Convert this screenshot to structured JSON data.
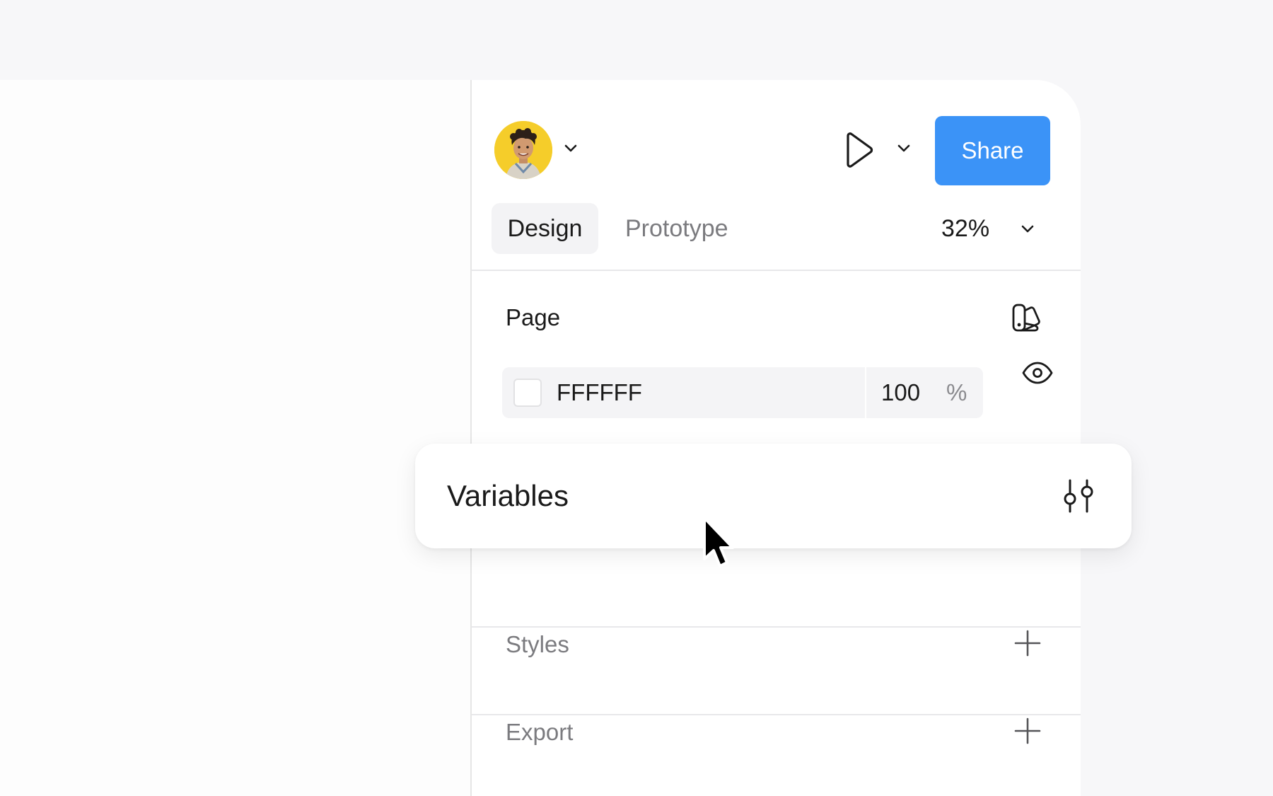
{
  "header": {
    "share_label": "Share"
  },
  "tabs": [
    {
      "label": "Design",
      "active": true
    },
    {
      "label": "Prototype",
      "active": false
    }
  ],
  "zoom": "32%",
  "page_section": {
    "title": "Page",
    "fill": {
      "hex": "FFFFFF",
      "opacity": "100",
      "unit": "%"
    }
  },
  "variables": {
    "title": "Variables"
  },
  "styles": {
    "title": "Styles"
  },
  "export": {
    "title": "Export"
  },
  "icons": {
    "user_chevron": "chevron-down-icon",
    "play": "play-icon",
    "swatch": "library-swatch-icon",
    "eye": "eye-icon",
    "variables": "sliders-icon",
    "add": "plus-icon"
  },
  "colors": {
    "accent": "#3b93f7",
    "avatar_bg": "#f5cd2a"
  }
}
